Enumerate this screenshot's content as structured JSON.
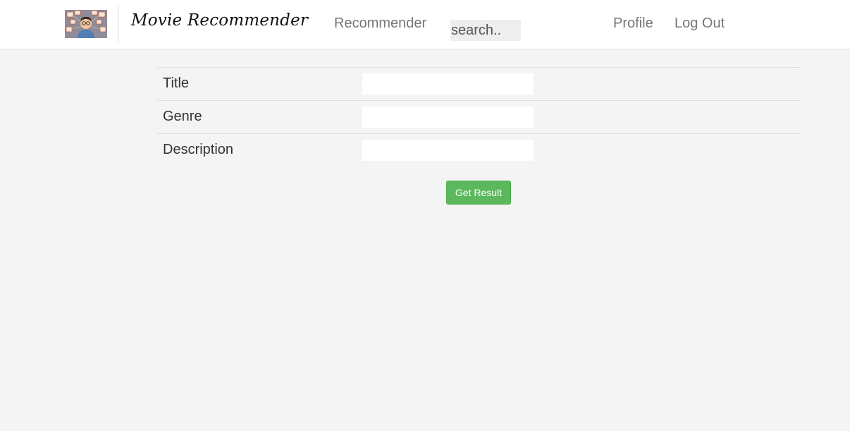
{
  "navbar": {
    "brand": "Movie Recommender",
    "links": {
      "recommender": "Recommender",
      "profile": "Profile",
      "logout": "Log Out"
    },
    "search": {
      "placeholder": "search..",
      "value": ""
    },
    "logo_icon": "person-with-movie-cards-illustration"
  },
  "form": {
    "fields": [
      {
        "label": "Title",
        "value": ""
      },
      {
        "label": "Genre",
        "value": ""
      },
      {
        "label": "Description",
        "value": ""
      }
    ],
    "submit_label": "Get Result"
  },
  "colors": {
    "page_background": "#f4f4f4",
    "navbar_background": "#ffffff",
    "submit_button": "#5cb85c",
    "nav_link_text": "#777777"
  }
}
